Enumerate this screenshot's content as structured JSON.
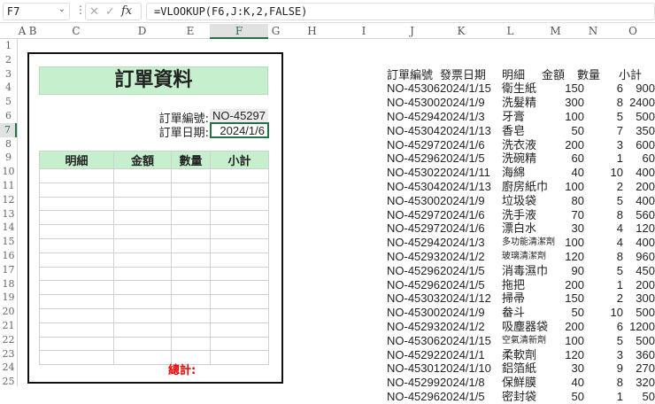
{
  "formula_bar": {
    "name_box": "F7",
    "formula": "=VLOOKUP(F6,J:K,2,FALSE)",
    "fx": "fx"
  },
  "columns": [
    "A",
    "B",
    "C",
    "D",
    "E",
    "F",
    "G",
    "H",
    "I",
    "J",
    "K",
    "L",
    "M",
    "N",
    "O"
  ],
  "rows": [
    "1",
    "2",
    "3",
    "4",
    "5",
    "6",
    "7",
    "8",
    "9",
    "10",
    "11",
    "12",
    "13",
    "14",
    "15",
    "16",
    "17",
    "18",
    "19",
    "20",
    "21",
    "22",
    "23",
    "24",
    "25"
  ],
  "form": {
    "title": "訂單資料",
    "order_no_label": "訂單編號:",
    "order_no": "NO-45297",
    "order_date_label": "訂單日期:",
    "order_date": "2024/1/6",
    "headers": [
      "明細",
      "金額",
      "數量",
      "小計"
    ],
    "total_label": "總計:"
  },
  "data_table": {
    "headers": [
      "訂單編號",
      "發票日期",
      "明細",
      "金額",
      "數量",
      "小計"
    ],
    "rows": [
      [
        "NO-45306",
        "2024/1/15",
        "衛生紙",
        "150",
        "6",
        "900"
      ],
      [
        "NO-45300",
        "2024/1/9",
        "洗髮精",
        "300",
        "8",
        "2400"
      ],
      [
        "NO-45294",
        "2024/1/3",
        "牙膏",
        "100",
        "5",
        "500"
      ],
      [
        "NO-45304",
        "2024/1/13",
        "香皂",
        "50",
        "7",
        "350"
      ],
      [
        "NO-45297",
        "2024/1/6",
        "洗衣液",
        "200",
        "3",
        "600"
      ],
      [
        "NO-45296",
        "2024/1/5",
        "洗碗精",
        "60",
        "1",
        "60"
      ],
      [
        "NO-45302",
        "2024/1/11",
        "海綿",
        "40",
        "10",
        "400"
      ],
      [
        "NO-45304",
        "2024/1/13",
        "廚房紙巾",
        "100",
        "2",
        "200"
      ],
      [
        "NO-45300",
        "2024/1/9",
        "垃圾袋",
        "80",
        "5",
        "400"
      ],
      [
        "NO-45297",
        "2024/1/6",
        "洗手液",
        "70",
        "8",
        "560"
      ],
      [
        "NO-45297",
        "2024/1/6",
        "漂白水",
        "30",
        "4",
        "120"
      ],
      [
        "NO-45294",
        "2024/1/3",
        "多功能清潔劑",
        "100",
        "4",
        "400"
      ],
      [
        "NO-45293",
        "2024/1/2",
        "玻璃清潔劑",
        "120",
        "8",
        "960"
      ],
      [
        "NO-45296",
        "2024/1/5",
        "消毒濕巾",
        "90",
        "5",
        "450"
      ],
      [
        "NO-45296",
        "2024/1/5",
        "拖把",
        "200",
        "1",
        "200"
      ],
      [
        "NO-45303",
        "2024/1/12",
        "掃帚",
        "150",
        "2",
        "300"
      ],
      [
        "NO-45300",
        "2024/1/9",
        "畚斗",
        "50",
        "10",
        "500"
      ],
      [
        "NO-45293",
        "2024/1/2",
        "吸塵器袋",
        "200",
        "6",
        "1200"
      ],
      [
        "NO-45306",
        "2024/1/15",
        "空氣清新劑",
        "100",
        "5",
        "500"
      ],
      [
        "NO-45292",
        "2024/1/1",
        "柔軟劑",
        "120",
        "3",
        "360"
      ],
      [
        "NO-45301",
        "2024/1/10",
        "鋁箔紙",
        "30",
        "9",
        "270"
      ],
      [
        "NO-45299",
        "2024/1/8",
        "保鮮膜",
        "40",
        "8",
        "320"
      ],
      [
        "NO-45296",
        "2024/1/5",
        "密封袋",
        "50",
        "1",
        "50"
      ]
    ]
  }
}
